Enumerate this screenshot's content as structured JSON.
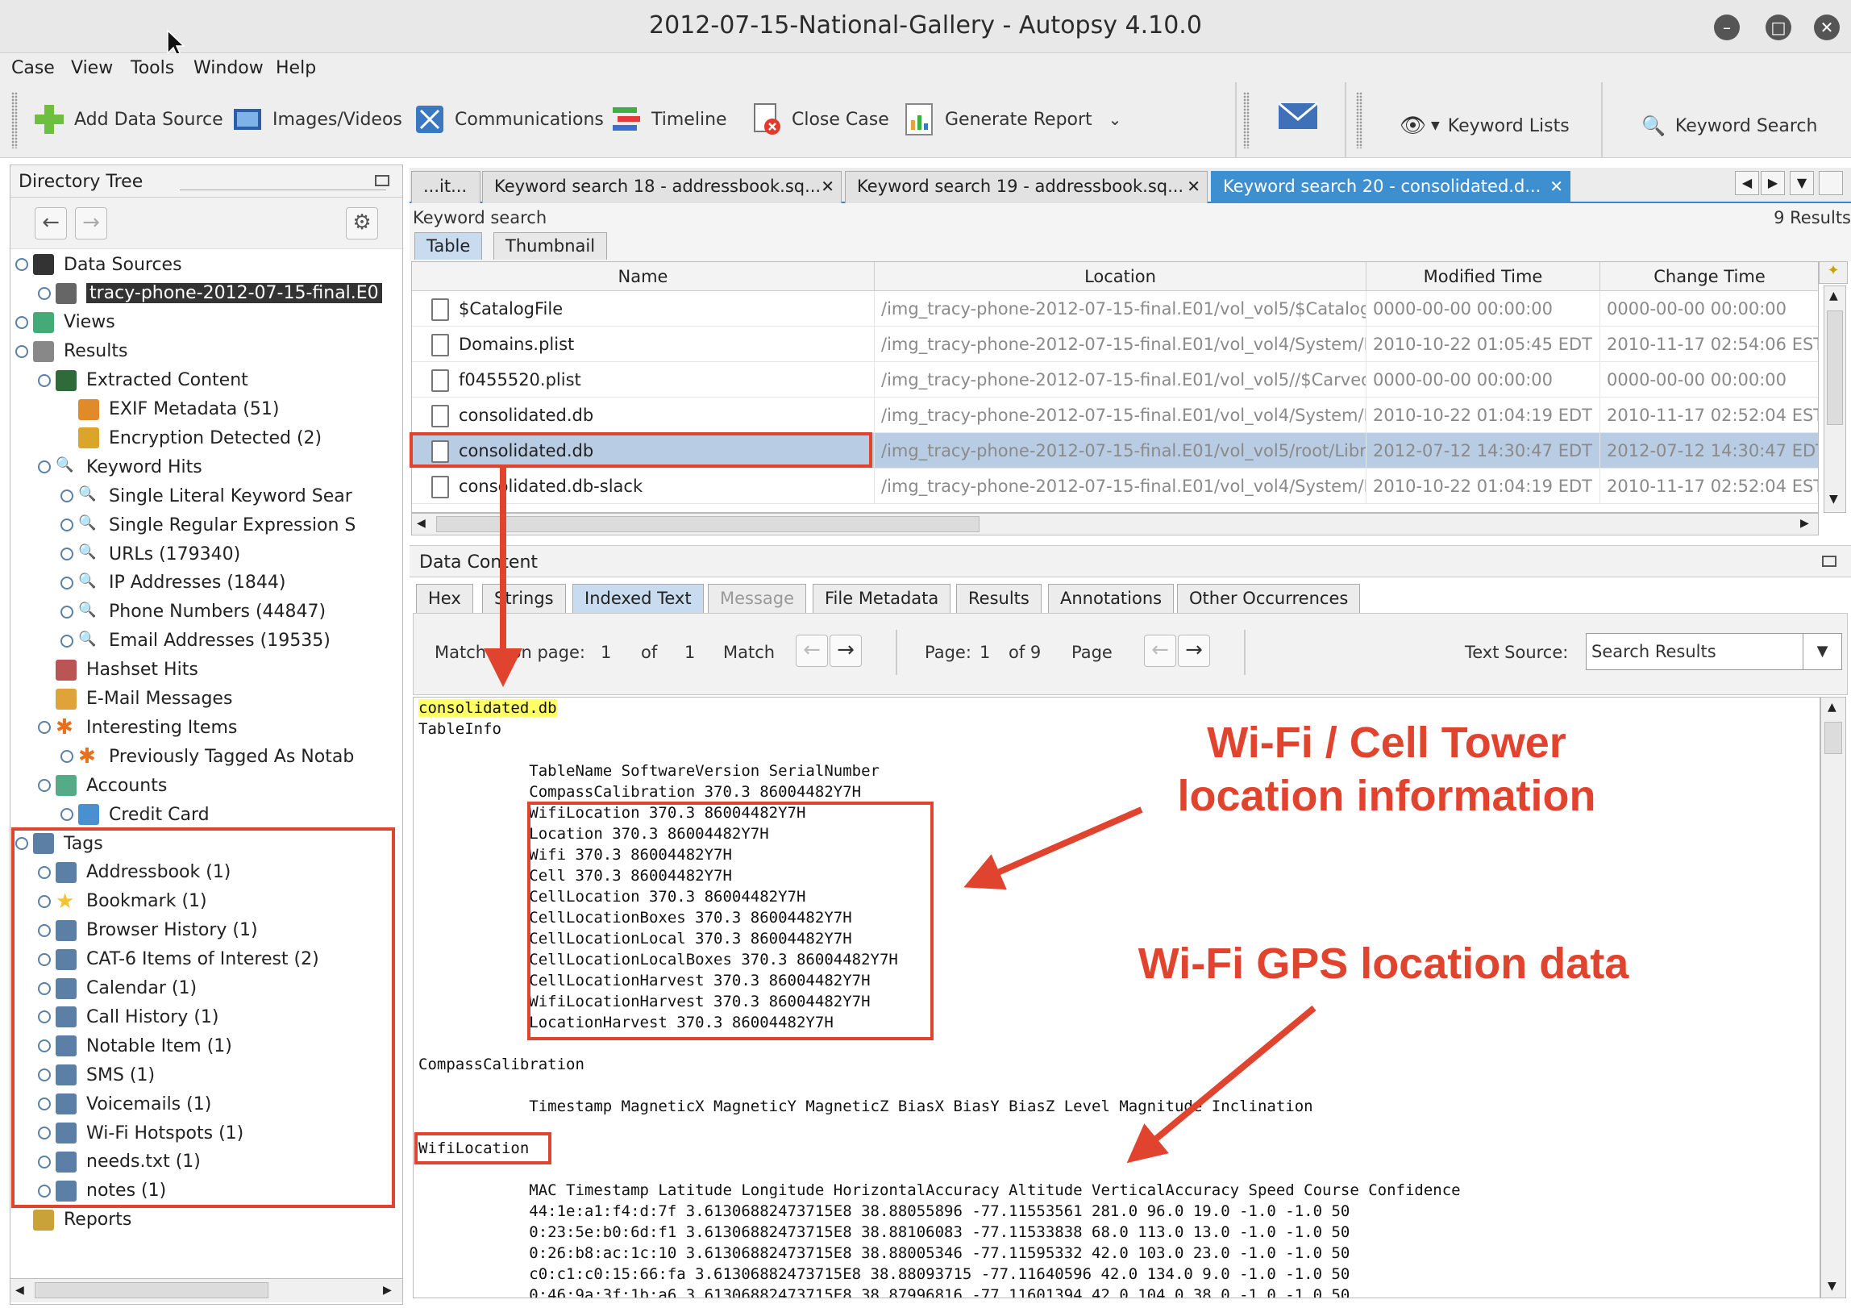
{
  "window": {
    "title": "2012-07-15-National-Gallery - Autopsy 4.10.0"
  },
  "menu": [
    "Case",
    "View",
    "Tools",
    "Window",
    "Help"
  ],
  "toolbar": {
    "add_data_source": "Add Data Source",
    "images_videos": "Images/Videos",
    "communications": "Communications",
    "timeline": "Timeline",
    "close_case": "Close Case",
    "generate_report": "Generate Report",
    "keyword_lists": "Keyword Lists",
    "keyword_search": "Keyword Search"
  },
  "directory_tree": {
    "title": "Directory Tree",
    "items": [
      {
        "label": "Data Sources"
      },
      {
        "label": "tracy-phone-2012-07-15-final.E0"
      },
      {
        "label": "Views"
      },
      {
        "label": "Results"
      },
      {
        "label": "Extracted Content"
      },
      {
        "label": "EXIF Metadata (51)"
      },
      {
        "label": "Encryption Detected (2)"
      },
      {
        "label": "Keyword Hits"
      },
      {
        "label": "Single Literal Keyword Sear"
      },
      {
        "label": "Single Regular Expression S"
      },
      {
        "label": "URLs (179340)"
      },
      {
        "label": "IP Addresses (1844)"
      },
      {
        "label": "Phone Numbers (44847)"
      },
      {
        "label": "Email Addresses (19535)"
      },
      {
        "label": "Hashset Hits"
      },
      {
        "label": "E-Mail Messages"
      },
      {
        "label": "Interesting Items"
      },
      {
        "label": "Previously Tagged As Notab"
      },
      {
        "label": "Accounts"
      },
      {
        "label": "Credit Card"
      },
      {
        "label": "Tags"
      },
      {
        "label": "Addressbook (1)"
      },
      {
        "label": "Bookmark (1)"
      },
      {
        "label": "Browser History (1)"
      },
      {
        "label": "CAT-6 Items of Interest (2)"
      },
      {
        "label": "Calendar (1)"
      },
      {
        "label": "Call History (1)"
      },
      {
        "label": "Notable Item (1)"
      },
      {
        "label": "SMS (1)"
      },
      {
        "label": "Voicemails (1)"
      },
      {
        "label": "Wi-Fi Hotspots (1)"
      },
      {
        "label": "needs.txt (1)"
      },
      {
        "label": "notes (1)"
      },
      {
        "label": "Reports"
      }
    ]
  },
  "tabs": [
    {
      "label": "...it..."
    },
    {
      "label": "Keyword search 18 - addressbook.sq..."
    },
    {
      "label": "Keyword search 19 - addressbook.sq..."
    },
    {
      "label": "Keyword search 20 - consolidated.d..."
    }
  ],
  "results": {
    "label": "Keyword search",
    "count": "9   Results",
    "view_tabs": [
      "Table",
      "Thumbnail"
    ],
    "columns": [
      "Name",
      "Location",
      "Modified Time",
      "Change Time"
    ],
    "rows": [
      {
        "name": "$CatalogFile",
        "location": "/img_tracy-phone-2012-07-15-final.E01/vol_vol5/$Catalog...",
        "modified": "0000-00-00 00:00:00",
        "changed": "0000-00-00 00:00:00"
      },
      {
        "name": "Domains.plist",
        "location": "/img_tracy-phone-2012-07-15-final.E01/vol_vol4/System/L...",
        "modified": "2010-10-22 01:05:45 EDT",
        "changed": "2010-11-17 02:54:06 EST"
      },
      {
        "name": "f0455520.plist",
        "location": "/img_tracy-phone-2012-07-15-final.E01/vol_vol5//$Carved...",
        "modified": "0000-00-00 00:00:00",
        "changed": "0000-00-00 00:00:00"
      },
      {
        "name": "consolidated.db",
        "location": "/img_tracy-phone-2012-07-15-final.E01/vol_vol4/System/L...",
        "modified": "2010-10-22 01:04:19 EDT",
        "changed": "2010-11-17 02:52:04 EST"
      },
      {
        "name": "consolidated.db",
        "location": "/img_tracy-phone-2012-07-15-final.E01/vol_vol5/root/Libra...",
        "modified": "2012-07-12 14:30:47 EDT",
        "changed": "2012-07-12 14:30:47 EDT"
      },
      {
        "name": "consolidated.db-slack",
        "location": "/img_tracy-phone-2012-07-15-final.E01/vol_vol4/System/L...",
        "modified": "2010-10-22 01:04:19 EDT",
        "changed": "2010-11-17 02:52:04 EST"
      }
    ]
  },
  "data_content": {
    "title": "Data Content",
    "tabs": [
      "Hex",
      "Strings",
      "Indexed Text",
      "Message",
      "File Metadata",
      "Results",
      "Annotations",
      "Other Occurrences"
    ],
    "matches_label": "Matches on page:",
    "match_num": "1",
    "of_label": "of",
    "match_total": "1",
    "match_label": "Match",
    "page_label": "Page:",
    "page_num": "1",
    "of_label2": "of 9",
    "page_word": "Page",
    "text_source_label": "Text Source:",
    "text_source_value": "Search Results",
    "lines": [
      "consolidated.db",
      "TableInfo",
      "",
      "            TableName SoftwareVersion SerialNumber",
      "            CompassCalibration 370.3 86004482Y7H",
      "            WifiLocation 370.3 86004482Y7H",
      "            Location 370.3 86004482Y7H",
      "            Wifi 370.3 86004482Y7H",
      "            Cell 370.3 86004482Y7H",
      "            CellLocation 370.3 86004482Y7H",
      "            CellLocationBoxes 370.3 86004482Y7H",
      "            CellLocationLocal 370.3 86004482Y7H",
      "            CellLocationLocalBoxes 370.3 86004482Y7H",
      "            CellLocationHarvest 370.3 86004482Y7H",
      "            WifiLocationHarvest 370.3 86004482Y7H",
      "            LocationHarvest 370.3 86004482Y7H",
      "",
      "CompassCalibration",
      "",
      "            Timestamp MagneticX MagneticY MagneticZ BiasX BiasY BiasZ Level Magnitude Inclination",
      "",
      "WifiLocation",
      "",
      "            MAC Timestamp Latitude Longitude HorizontalAccuracy Altitude VerticalAccuracy Speed Course Confidence",
      "            44:1e:a1:f4:d:7f 3.61306882473715E8 38.88055896 -77.11553561 281.0 96.0 19.0 -1.0 -1.0 50",
      "            0:23:5e:b0:6d:f1 3.61306882473715E8 38.88106083 -77.11533838 68.0 113.0 13.0 -1.0 -1.0 50",
      "            0:26:b8:ac:1c:10 3.61306882473715E8 38.88005346 -77.11595332 42.0 103.0 23.0 -1.0 -1.0 50",
      "            c0:c1:c0:15:66:fa 3.61306882473715E8 38.88093715 -77.11640596 42.0 134.0 9.0 -1.0 -1.0 50",
      "            0:46:9a:3f:1b:a6 3.61306882473715E8 38.87996816 -77.11601394 42.0 104.0 38.0 -1.0 -1.0 50"
    ]
  },
  "annotations": {
    "cell_tower": "Wi-Fi / Cell Tower\nlocation information",
    "wifi_gps": "Wi-Fi GPS location data"
  },
  "colors": {
    "annotation": "#e0442f",
    "highlight": "#ffff66",
    "selected_row": "#b8cce4",
    "active_tab": "#3d8fd0"
  }
}
